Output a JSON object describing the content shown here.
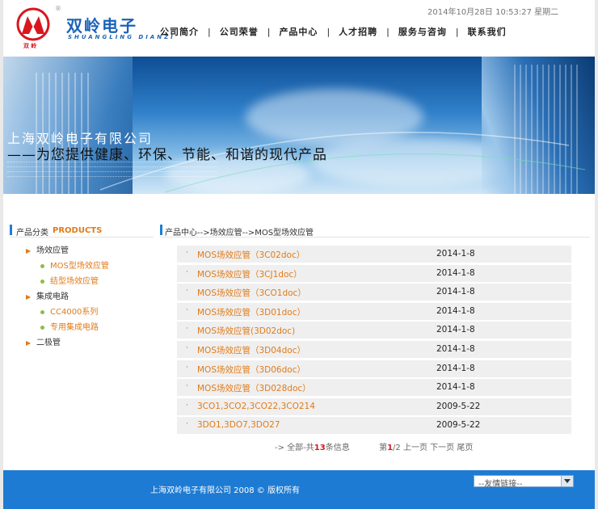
{
  "header": {
    "logo_cn": "双岭电子",
    "logo_en": "SHUANGLING DIANZI",
    "logo_small": "双 岭",
    "registered_mark": "®",
    "date": "2014年10月28日 10:53:27 星期二",
    "nav": [
      "公司简介",
      "公司荣誉",
      "产品中心",
      "人才招聘",
      "服务与咨询",
      "联系我们"
    ],
    "nav_separator": "|"
  },
  "banner": {
    "title1": "上海双岭电子有限公司",
    "title2": "——为您提供健康、环保、节能、和谐的现代产品"
  },
  "sidebar": {
    "title": "产品分类",
    "title_en": "PRODUCTS",
    "tree": [
      {
        "label": "场效应管",
        "level": 1
      },
      {
        "label": "MOS型场效应管",
        "level": 2
      },
      {
        "label": "结型场效应管",
        "level": 2
      },
      {
        "label": "集成电路",
        "level": 1
      },
      {
        "label": "CC4000系列",
        "level": 2
      },
      {
        "label": "专用集成电路",
        "level": 2
      },
      {
        "label": "二极管",
        "level": 1
      }
    ]
  },
  "breadcrumb": "产品中心-->场效应管-->MOS型场效应管",
  "list": {
    "bullet": "·",
    "rows": [
      {
        "name": "MOS场效应管（3C02doc）",
        "date": "2014-1-8"
      },
      {
        "name": "MOS场效应管（3CJ1doc）",
        "date": "2014-1-8"
      },
      {
        "name": "MOS场效应管（3CO1doc）",
        "date": "2014-1-8"
      },
      {
        "name": "MOS场效应管（3D01doc）",
        "date": "2014-1-8"
      },
      {
        "name": "MOS场效应管(3D02doc)",
        "date": "2014-1-8"
      },
      {
        "name": "MOS场效应管（3D04doc）",
        "date": "2014-1-8"
      },
      {
        "name": "MOS场效应管（3D06doc）",
        "date": "2014-1-8"
      },
      {
        "name": "MOS场效应管（3D028doc）",
        "date": "2014-1-8"
      },
      {
        "name": "3CO1,3CO2,3CO22,3CO214",
        "date": "2009-5-22"
      },
      {
        "name": "3DO1,3DO7,3DO27",
        "date": "2009-5-22"
      }
    ]
  },
  "pager": {
    "prefix": "-> 全部-共",
    "total": "13",
    "suffix": "条信息",
    "page_prefix": "第",
    "current": "1",
    "page_suffix": "/2",
    "prev": "上一页",
    "next": "下一页",
    "last": "尾页"
  },
  "footer": {
    "copyright": "上海双岭电子有限公司  2008  © 版权所有",
    "friend_links": "--友情链接--"
  },
  "colors": {
    "accent_blue": "#1e7bd3",
    "link_orange": "#e07b1a",
    "count_red": "#d9161e"
  }
}
